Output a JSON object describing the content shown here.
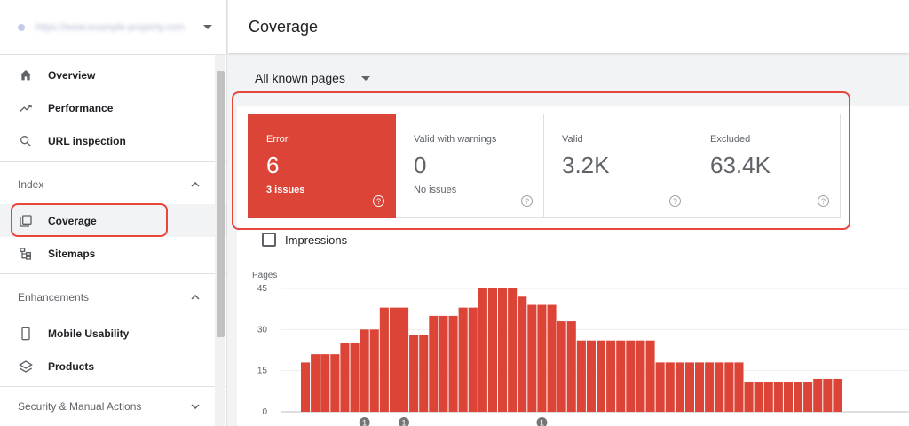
{
  "sidebar": {
    "property": "https://www.example-property.com",
    "nav_top": [
      {
        "label": "Overview",
        "icon": "home-icon"
      },
      {
        "label": "Performance",
        "icon": "trending-up-icon"
      },
      {
        "label": "URL inspection",
        "icon": "search-icon"
      }
    ],
    "index_section": "Index",
    "index_items": [
      {
        "label": "Coverage",
        "icon": "coverage-icon",
        "active": true
      },
      {
        "label": "Sitemaps",
        "icon": "sitemap-icon"
      }
    ],
    "enhancements_section": "Enhancements",
    "enhancement_items": [
      {
        "label": "Mobile Usability",
        "icon": "phone-icon"
      },
      {
        "label": "Products",
        "icon": "layers-icon"
      }
    ],
    "security_section": "Security & Manual Actions"
  },
  "header": {
    "title": "Coverage"
  },
  "filter": {
    "label": "All known pages"
  },
  "status_cards": [
    {
      "label": "Error",
      "value": "6",
      "sub": "3 issues"
    },
    {
      "label": "Valid with warnings",
      "value": "0",
      "sub": "No issues"
    },
    {
      "label": "Valid",
      "value": "3.2K",
      "sub": ""
    },
    {
      "label": "Excluded",
      "value": "63.4K",
      "sub": ""
    }
  ],
  "impressions": {
    "label": "Impressions"
  },
  "colors": {
    "error": "#db4437",
    "highlight": "#e8453c"
  },
  "chart_data": {
    "type": "bar",
    "ylabel": "Pages",
    "yticks": [
      0,
      15,
      30,
      45
    ],
    "ylim": [
      0,
      45
    ],
    "values": [
      18,
      21,
      21,
      21,
      25,
      25,
      30,
      30,
      38,
      38,
      38,
      28,
      28,
      35,
      35,
      35,
      38,
      38,
      45,
      45,
      45,
      45,
      42,
      39,
      39,
      39,
      33,
      33,
      26,
      26,
      26,
      26,
      26,
      26,
      26,
      26,
      18,
      18,
      18,
      18,
      18,
      18,
      18,
      18,
      18,
      11,
      11,
      11,
      11,
      11,
      11,
      11,
      12,
      12,
      12
    ],
    "annotations": [
      {
        "bar_index": 6,
        "label": "1"
      },
      {
        "bar_index": 10,
        "label": "1"
      },
      {
        "bar_index": 24,
        "label": "1"
      }
    ]
  }
}
